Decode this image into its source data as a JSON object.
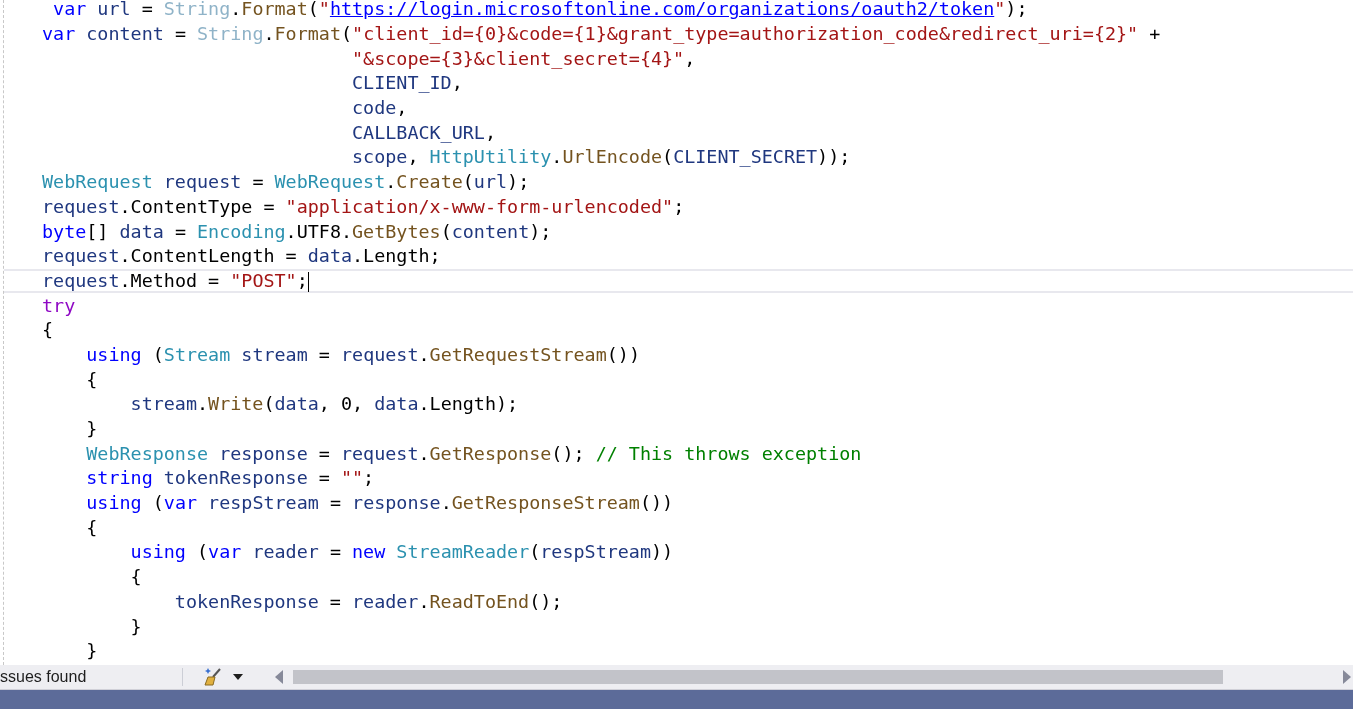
{
  "editor": {
    "lines": [
      {
        "kind": "offset",
        "current": false,
        "tokens": [
          {
            "kind": "kw",
            "text": "var "
          },
          {
            "kind": "var",
            "text": "url"
          },
          {
            "kind": "plain",
            "text": " = "
          },
          {
            "kind": "dim",
            "text": "String"
          },
          {
            "kind": "plain",
            "text": "."
          },
          {
            "kind": "method",
            "text": "Format"
          },
          {
            "kind": "plain",
            "text": "("
          },
          {
            "kind": "str",
            "text": "\""
          },
          {
            "kind": "link",
            "text": "https://login.microsoftonline.com/organizations/oauth2/token"
          },
          {
            "kind": "str",
            "text": "\""
          },
          {
            "kind": "plain",
            "text": ");"
          }
        ]
      },
      {
        "kind": "code",
        "current": false,
        "tokens": [
          {
            "kind": "kw",
            "text": "var "
          },
          {
            "kind": "var",
            "text": "content"
          },
          {
            "kind": "plain",
            "text": " = "
          },
          {
            "kind": "dim",
            "text": "String"
          },
          {
            "kind": "plain",
            "text": "."
          },
          {
            "kind": "method",
            "text": "Format"
          },
          {
            "kind": "plain",
            "text": "("
          },
          {
            "kind": "str",
            "text": "\"client_id={0}&code={1}&grant_type=authorization_code&redirect_uri={2}\""
          },
          {
            "kind": "plain",
            "text": " +"
          }
        ]
      },
      {
        "kind": "continuation",
        "current": false,
        "tokens": [
          {
            "kind": "str",
            "text": "\"&scope={3}&client_secret={4}\""
          },
          {
            "kind": "plain",
            "text": ","
          }
        ]
      },
      {
        "kind": "continuation",
        "current": false,
        "tokens": [
          {
            "kind": "var",
            "text": "CLIENT_ID"
          },
          {
            "kind": "plain",
            "text": ","
          }
        ]
      },
      {
        "kind": "continuation",
        "current": false,
        "tokens": [
          {
            "kind": "var",
            "text": "code"
          },
          {
            "kind": "plain",
            "text": ","
          }
        ]
      },
      {
        "kind": "continuation",
        "current": false,
        "tokens": [
          {
            "kind": "var",
            "text": "CALLBACK_URL"
          },
          {
            "kind": "plain",
            "text": ","
          }
        ]
      },
      {
        "kind": "continuation",
        "current": false,
        "tokens": [
          {
            "kind": "var",
            "text": "scope"
          },
          {
            "kind": "plain",
            "text": ", "
          },
          {
            "kind": "type",
            "text": "HttpUtility"
          },
          {
            "kind": "plain",
            "text": "."
          },
          {
            "kind": "method",
            "text": "UrlEncode"
          },
          {
            "kind": "plain",
            "text": "("
          },
          {
            "kind": "var",
            "text": "CLIENT_SECRET"
          },
          {
            "kind": "plain",
            "text": "));"
          }
        ]
      },
      {
        "kind": "code",
        "current": false,
        "tokens": [
          {
            "kind": "type",
            "text": "WebRequest "
          },
          {
            "kind": "var",
            "text": "request"
          },
          {
            "kind": "plain",
            "text": " = "
          },
          {
            "kind": "type",
            "text": "WebRequest"
          },
          {
            "kind": "plain",
            "text": "."
          },
          {
            "kind": "method",
            "text": "Create"
          },
          {
            "kind": "plain",
            "text": "("
          },
          {
            "kind": "var",
            "text": "url"
          },
          {
            "kind": "plain",
            "text": ");"
          }
        ]
      },
      {
        "kind": "code",
        "current": false,
        "tokens": [
          {
            "kind": "var",
            "text": "request"
          },
          {
            "kind": "plain",
            "text": ".ContentType = "
          },
          {
            "kind": "str",
            "text": "\"application/x-www-form-urlencoded\""
          },
          {
            "kind": "plain",
            "text": ";"
          }
        ]
      },
      {
        "kind": "code",
        "current": false,
        "tokens": [
          {
            "kind": "kw",
            "text": "byte"
          },
          {
            "kind": "plain",
            "text": "[] "
          },
          {
            "kind": "var",
            "text": "data"
          },
          {
            "kind": "plain",
            "text": " = "
          },
          {
            "kind": "type",
            "text": "Encoding"
          },
          {
            "kind": "plain",
            "text": ".UTF8."
          },
          {
            "kind": "method",
            "text": "GetBytes"
          },
          {
            "kind": "plain",
            "text": "("
          },
          {
            "kind": "var",
            "text": "content"
          },
          {
            "kind": "plain",
            "text": ");"
          }
        ]
      },
      {
        "kind": "code",
        "current": false,
        "tokens": [
          {
            "kind": "var",
            "text": "request"
          },
          {
            "kind": "plain",
            "text": ".ContentLength = "
          },
          {
            "kind": "var",
            "text": "data"
          },
          {
            "kind": "plain",
            "text": ".Length;"
          }
        ]
      },
      {
        "kind": "code",
        "current": true,
        "tokens": [
          {
            "kind": "var",
            "text": "request"
          },
          {
            "kind": "plain",
            "text": ".Method = "
          },
          {
            "kind": "str",
            "text": "\"POST\""
          },
          {
            "kind": "plain",
            "text": ";"
          }
        ]
      },
      {
        "kind": "code",
        "current": false,
        "tokens": [
          {
            "kind": "ctrl",
            "text": "try"
          }
        ]
      },
      {
        "kind": "code",
        "current": false,
        "tokens": [
          {
            "kind": "plain",
            "text": "{"
          }
        ],
        "children": [
          {
            "kind": "code",
            "current": false,
            "tokens": [
              {
                "kind": "kw",
                "text": "using"
              },
              {
                "kind": "plain",
                "text": " ("
              },
              {
                "kind": "type",
                "text": "Stream "
              },
              {
                "kind": "var",
                "text": "stream"
              },
              {
                "kind": "plain",
                "text": " = "
              },
              {
                "kind": "var",
                "text": "request"
              },
              {
                "kind": "plain",
                "text": "."
              },
              {
                "kind": "method",
                "text": "GetRequestStream"
              },
              {
                "kind": "plain",
                "text": "())"
              }
            ]
          },
          {
            "kind": "code",
            "current": false,
            "tokens": [
              {
                "kind": "plain",
                "text": "{"
              }
            ],
            "children": [
              {
                "kind": "code",
                "current": false,
                "tokens": [
                  {
                    "kind": "var",
                    "text": "stream"
                  },
                  {
                    "kind": "plain",
                    "text": "."
                  },
                  {
                    "kind": "method",
                    "text": "Write"
                  },
                  {
                    "kind": "plain",
                    "text": "("
                  },
                  {
                    "kind": "var",
                    "text": "data"
                  },
                  {
                    "kind": "plain",
                    "text": ", 0, "
                  },
                  {
                    "kind": "var",
                    "text": "data"
                  },
                  {
                    "kind": "plain",
                    "text": ".Length);"
                  }
                ]
              }
            ]
          },
          {
            "kind": "code",
            "current": false,
            "tokens": [
              {
                "kind": "plain",
                "text": "}"
              }
            ]
          },
          {
            "kind": "code",
            "current": false,
            "tokens": [
              {
                "kind": "type",
                "text": "WebResponse "
              },
              {
                "kind": "var",
                "text": "response"
              },
              {
                "kind": "plain",
                "text": " = "
              },
              {
                "kind": "var",
                "text": "request"
              },
              {
                "kind": "plain",
                "text": "."
              },
              {
                "kind": "method",
                "text": "GetResponse"
              },
              {
                "kind": "plain",
                "text": "(); "
              },
              {
                "kind": "comment",
                "text": "// This throws exception"
              }
            ]
          },
          {
            "kind": "code",
            "current": false,
            "tokens": [
              {
                "kind": "kw",
                "text": "string "
              },
              {
                "kind": "var",
                "text": "tokenResponse"
              },
              {
                "kind": "plain",
                "text": " = "
              },
              {
                "kind": "str",
                "text": "\"\""
              },
              {
                "kind": "plain",
                "text": ";"
              }
            ]
          },
          {
            "kind": "code",
            "current": false,
            "tokens": [
              {
                "kind": "kw",
                "text": "using"
              },
              {
                "kind": "plain",
                "text": " ("
              },
              {
                "kind": "kw",
                "text": "var "
              },
              {
                "kind": "var",
                "text": "respStream"
              },
              {
                "kind": "plain",
                "text": " = "
              },
              {
                "kind": "var",
                "text": "response"
              },
              {
                "kind": "plain",
                "text": "."
              },
              {
                "kind": "method",
                "text": "GetResponseStream"
              },
              {
                "kind": "plain",
                "text": "())"
              }
            ]
          },
          {
            "kind": "code",
            "current": false,
            "tokens": [
              {
                "kind": "plain",
                "text": "{"
              }
            ],
            "children": [
              {
                "kind": "code",
                "current": false,
                "tokens": [
                  {
                    "kind": "kw",
                    "text": "using"
                  },
                  {
                    "kind": "plain",
                    "text": " ("
                  },
                  {
                    "kind": "kw",
                    "text": "var "
                  },
                  {
                    "kind": "var",
                    "text": "reader"
                  },
                  {
                    "kind": "plain",
                    "text": " = "
                  },
                  {
                    "kind": "kw",
                    "text": "new "
                  },
                  {
                    "kind": "type",
                    "text": "StreamReader"
                  },
                  {
                    "kind": "plain",
                    "text": "("
                  },
                  {
                    "kind": "var",
                    "text": "respStream"
                  },
                  {
                    "kind": "plain",
                    "text": "))"
                  }
                ]
              },
              {
                "kind": "code",
                "current": false,
                "tokens": [
                  {
                    "kind": "plain",
                    "text": "{"
                  }
                ],
                "children": [
                  {
                    "kind": "code",
                    "current": false,
                    "tokens": [
                      {
                        "kind": "var",
                        "text": "tokenResponse"
                      },
                      {
                        "kind": "plain",
                        "text": " = "
                      },
                      {
                        "kind": "var",
                        "text": "reader"
                      },
                      {
                        "kind": "plain",
                        "text": "."
                      },
                      {
                        "kind": "method",
                        "text": "ReadToEnd"
                      },
                      {
                        "kind": "plain",
                        "text": "();"
                      }
                    ]
                  }
                ]
              },
              {
                "kind": "code",
                "current": false,
                "tokens": [
                  {
                    "kind": "plain",
                    "text": "}"
                  }
                ]
              }
            ]
          },
          {
            "kind": "code",
            "current": false,
            "tokens": [
              {
                "kind": "plain",
                "text": "}"
              }
            ]
          }
        ]
      }
    ]
  },
  "bottom_bar": {
    "issues_text": "ssues found"
  }
}
